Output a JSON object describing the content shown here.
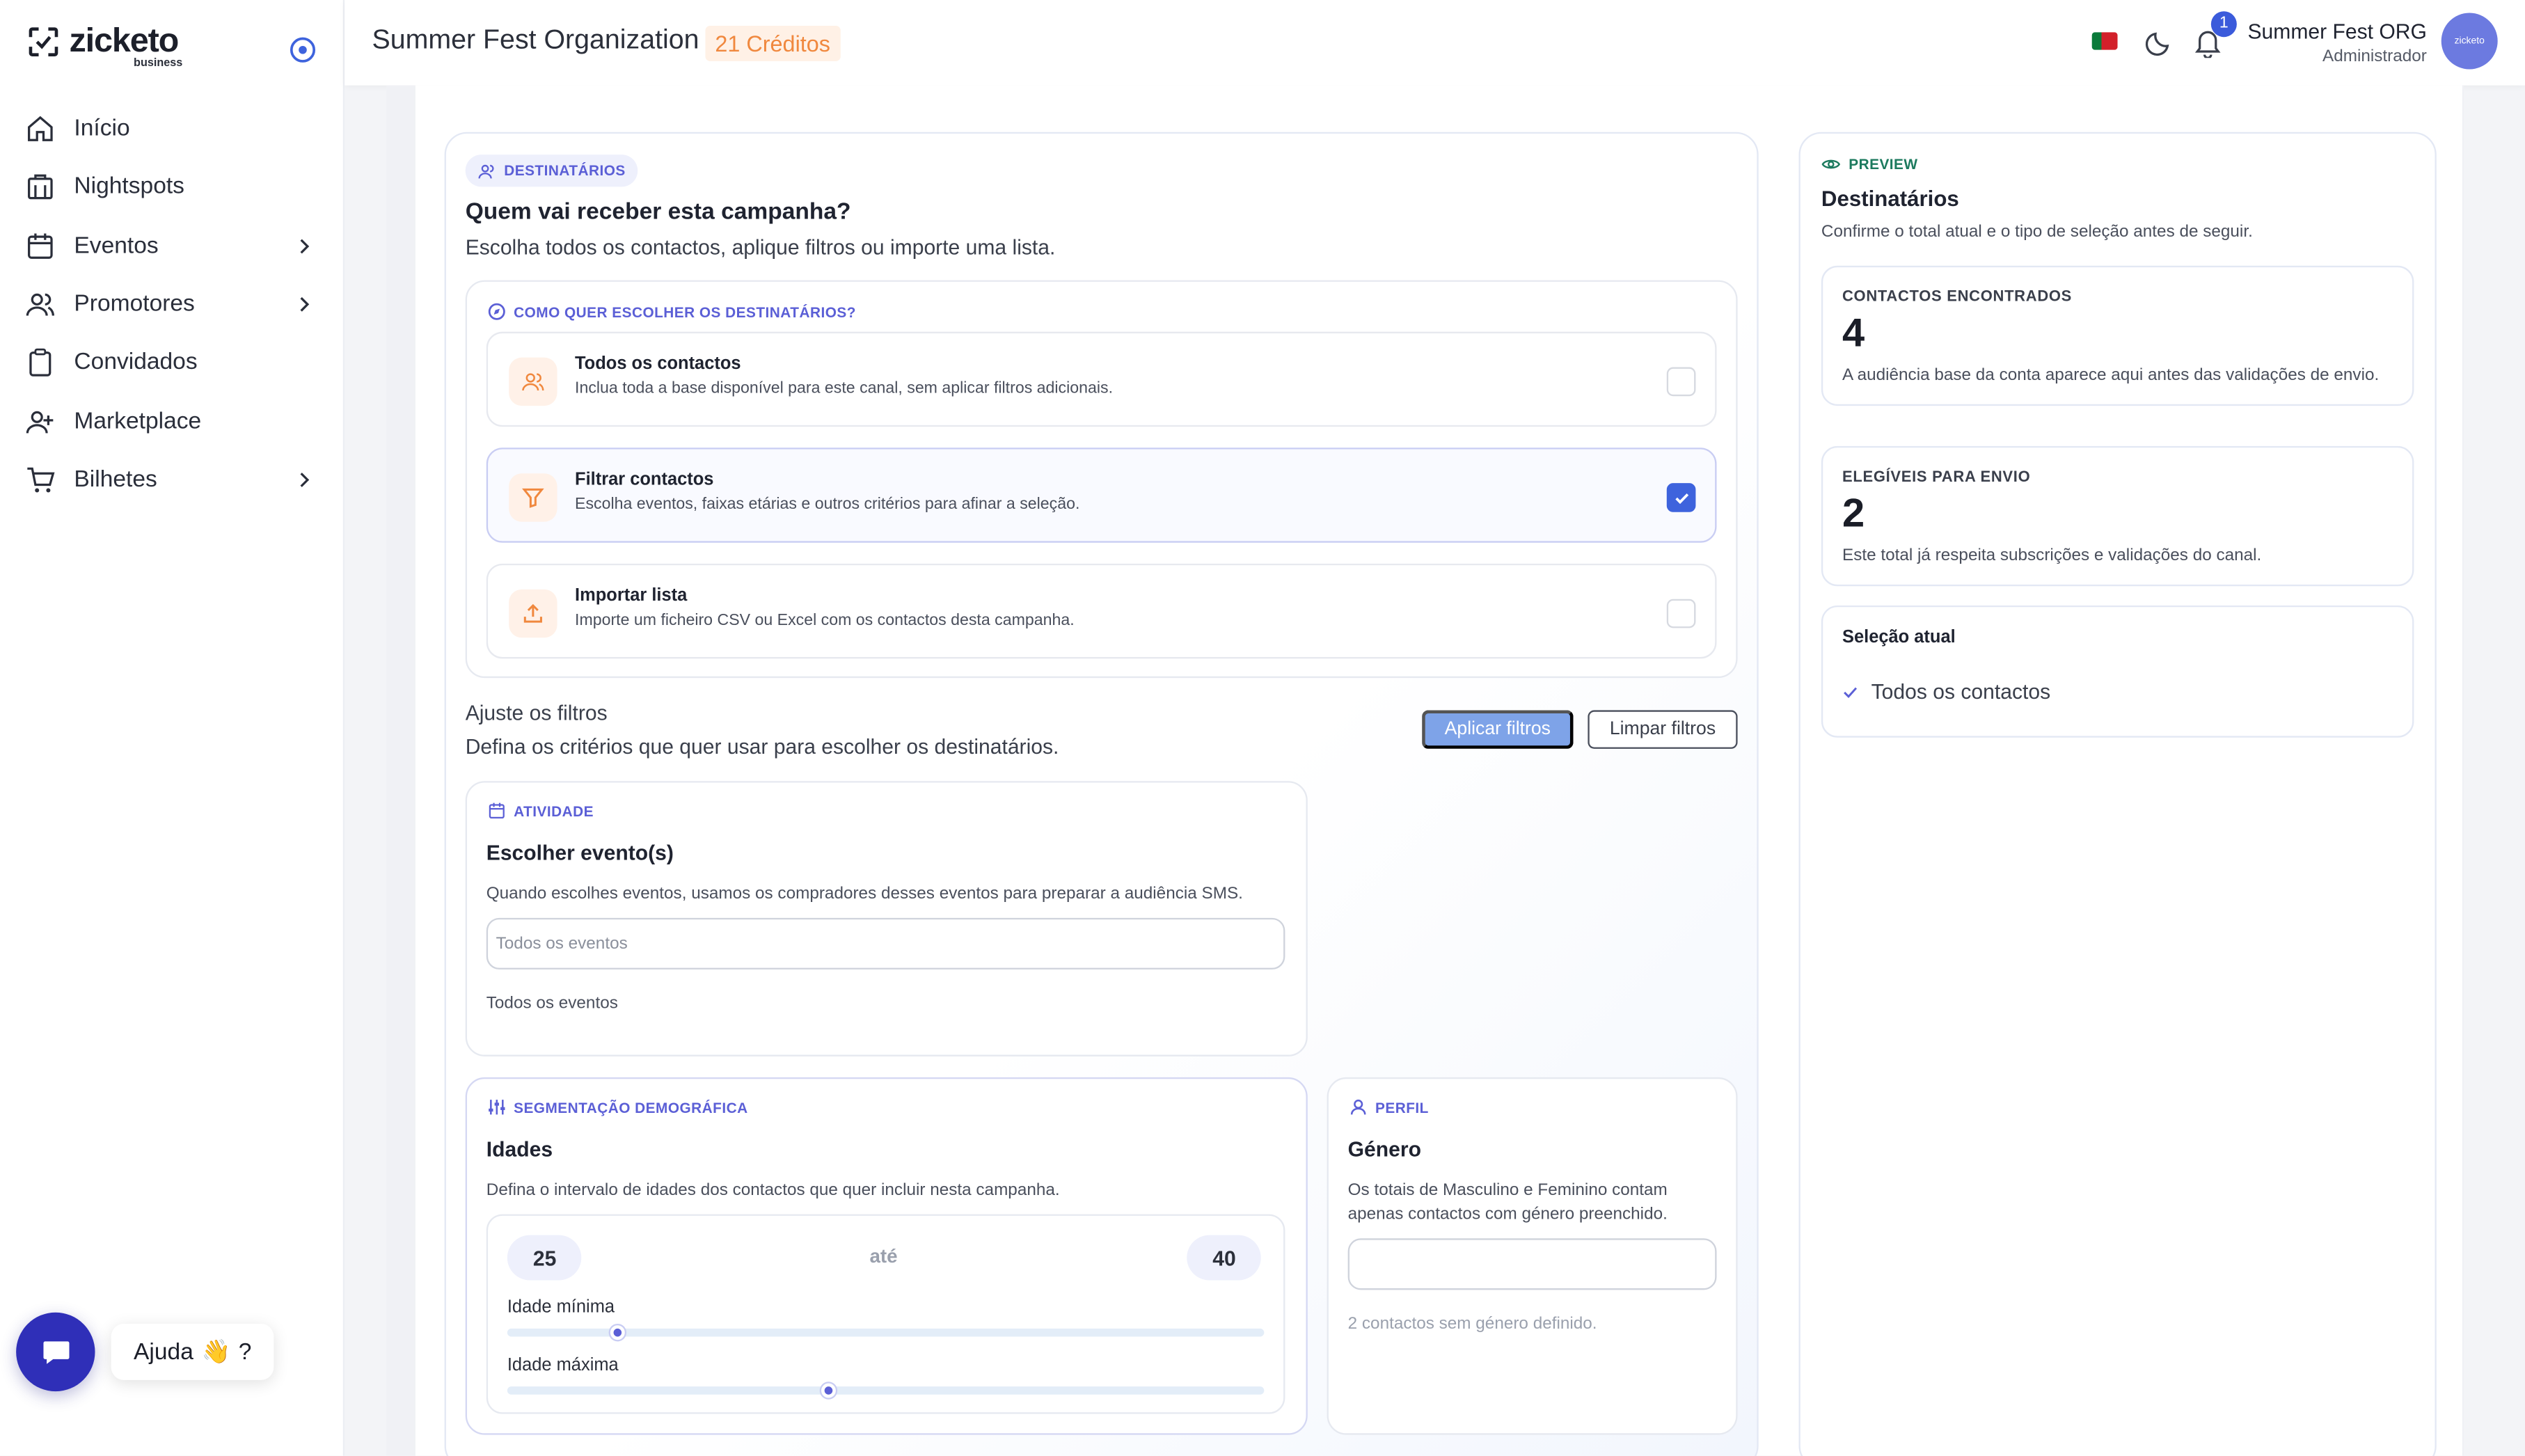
{
  "brand": {
    "name": "zicketo",
    "sub": "business"
  },
  "sidebar": {
    "items": [
      {
        "label": "Início",
        "icon": "home-icon",
        "has_children": false
      },
      {
        "label": "Nightspots",
        "icon": "building-icon",
        "has_children": false
      },
      {
        "label": "Eventos",
        "icon": "calendar-icon",
        "has_children": true
      },
      {
        "label": "Promotores",
        "icon": "users-icon",
        "has_children": true
      },
      {
        "label": "Convidados",
        "icon": "clipboard-icon",
        "has_children": false
      },
      {
        "label": "Marketplace",
        "icon": "user-plus-icon",
        "has_children": false
      },
      {
        "label": "Bilhetes",
        "icon": "cart-icon",
        "has_children": true
      }
    ]
  },
  "help": {
    "label": "Ajuda",
    "emoji": "👋",
    "suffix": "?"
  },
  "topbar": {
    "org_title": "Summer Fest Organization",
    "credits": "21 Créditos",
    "notification_count": "1",
    "user_name": "Summer Fest ORG",
    "user_role": "Administrador",
    "avatar_text": "zicketo"
  },
  "recipients": {
    "pill": "DESTINATÁRIOS",
    "title": "Quem vai receber esta campanha?",
    "subtitle": "Escolha todos os contactos, aplique filtros ou importe uma lista.",
    "choose_head": "COMO QUER ESCOLHER OS DESTINATÁRIOS?",
    "options": [
      {
        "title": "Todos os contactos",
        "desc": "Inclua toda a base disponível para este canal, sem aplicar filtros adicionais.",
        "checked": false
      },
      {
        "title": "Filtrar contactos",
        "desc": "Escolha eventos, faixas etárias e outros critérios para afinar a seleção.",
        "checked": true
      },
      {
        "title": "Importar lista",
        "desc": "Importe um ficheiro CSV ou Excel com os contactos desta campanha.",
        "checked": false
      }
    ]
  },
  "filters": {
    "title": "Ajuste os filtros",
    "subtitle": "Defina os critérios que quer usar para escolher os destinatários.",
    "apply": "Aplicar filtros",
    "clear": "Limpar filtros"
  },
  "activity": {
    "head": "ATIVIDADE",
    "title": "Escolher evento(s)",
    "desc": "Quando escolhes eventos, usamos os compradores desses eventos para preparar a audiência SMS.",
    "placeholder": "Todos os eventos",
    "selected_text": "Todos os eventos"
  },
  "demographics": {
    "head": "SEGMENTAÇÃO DEMOGRÁFICA",
    "title": "Idades",
    "desc": "Defina o intervalo de idades dos contactos que quer incluir nesta campanha.",
    "min_age": "25",
    "max_age": "40",
    "between": "até",
    "min_label": "Idade mínima",
    "max_label": "Idade máxima",
    "min_slider_fraction": 0.145,
    "max_slider_fraction": 0.425
  },
  "profile": {
    "head": "PERFIL",
    "title": "Género",
    "desc": "Os totais de Masculino e Feminino contam apenas contactos com género preenchido.",
    "note": "2 contactos sem género definido."
  },
  "preview": {
    "head": "PREVIEW",
    "title": "Destinatários",
    "subtitle": "Confirme o total atual e o tipo de seleção antes de seguir.",
    "found_label": "CONTACTOS ENCONTRADOS",
    "found_value": "4",
    "found_desc": "A audiência base da conta aparece aqui antes das validações de envio.",
    "eligible_label": "ELEGÍVEIS PARA ENVIO",
    "eligible_value": "2",
    "eligible_desc": "Este total já respeita subscrições e validações do canal.",
    "selection_title": "Seleção atual",
    "selection_item": "Todos os contactos"
  },
  "colors": {
    "accent": "#5b5fd6",
    "primary_button": "#7ea3e8",
    "checkbox_on": "#3e63dd",
    "credits": "#f0883e",
    "preview_head": "#1c7a5e"
  }
}
